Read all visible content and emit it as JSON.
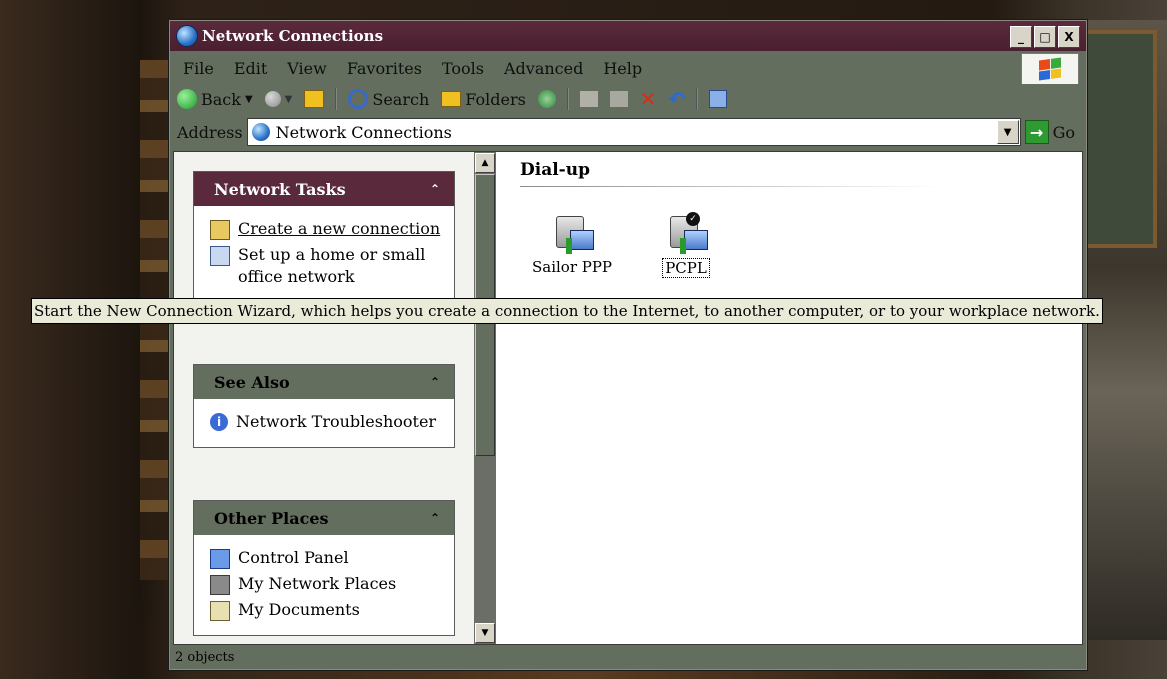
{
  "window": {
    "title": "Network Connections",
    "buttons": {
      "minimize": "_",
      "maximize": "□",
      "close": "X"
    }
  },
  "menu": [
    "File",
    "Edit",
    "View",
    "Favorites",
    "Tools",
    "Advanced",
    "Help"
  ],
  "toolbar": {
    "back_label": "Back",
    "search_label": "Search",
    "folders_label": "Folders"
  },
  "address": {
    "label": "Address",
    "value": "Network Connections",
    "go_label": "Go"
  },
  "panels": {
    "network_tasks": {
      "title": "Network Tasks",
      "items": [
        "Create a new connection",
        "Set up a home or small office network"
      ]
    },
    "see_also": {
      "title": "See Also",
      "items": [
        "Network Troubleshooter"
      ]
    },
    "other_places": {
      "title": "Other Places",
      "items": [
        "Control Panel",
        "My Network Places",
        "My Documents"
      ]
    }
  },
  "main": {
    "group": "Dial-up",
    "connections": [
      {
        "name": "Sailor PPP",
        "selected": false
      },
      {
        "name": "PCPL",
        "selected": true
      }
    ]
  },
  "status": {
    "text": "2 objects"
  },
  "tooltip": {
    "text": "Start the New Connection Wizard, which helps you create a connection to the Internet, to another computer, or to your workplace network."
  },
  "colors": {
    "title_bar": "#5a2a3c",
    "chrome": "#646e5f",
    "tooltip_bg": "#e9ead8"
  }
}
